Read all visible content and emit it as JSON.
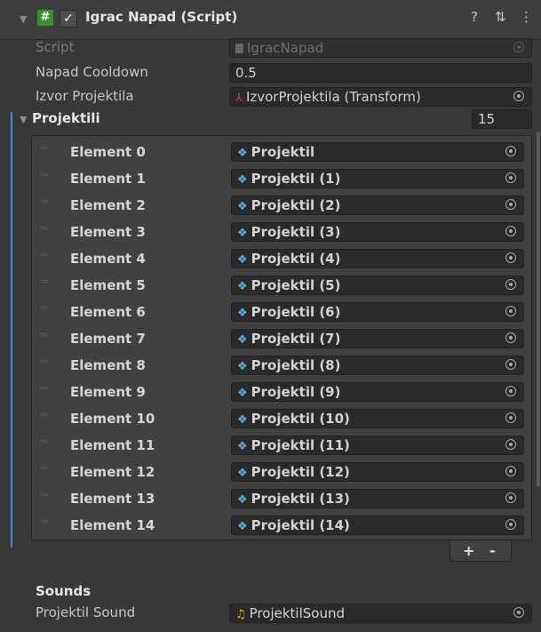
{
  "header": {
    "title": "Igrac Napad (Script)",
    "script_icon_glyph": "#",
    "check_glyph": "✓",
    "help_icon": "?",
    "preset_icon": "⇅",
    "menu_icon": "⋮"
  },
  "fields": {
    "script_label": "Script",
    "script_value": "IgracNapad",
    "cooldown_label": "Napad Cooldown",
    "cooldown_value": "0.5",
    "izvor_label": "Izvor Projektila",
    "izvor_value": "IzvorProjektila (Transform)"
  },
  "projektili": {
    "label": "Projektili",
    "count": "15",
    "elements": [
      {
        "label": "Element 0",
        "value": "Projektil"
      },
      {
        "label": "Element 1",
        "value": "Projektil (1)"
      },
      {
        "label": "Element 2",
        "value": "Projektil (2)"
      },
      {
        "label": "Element 3",
        "value": "Projektil (3)"
      },
      {
        "label": "Element 4",
        "value": "Projektil (4)"
      },
      {
        "label": "Element 5",
        "value": "Projektil (5)"
      },
      {
        "label": "Element 6",
        "value": "Projektil (6)"
      },
      {
        "label": "Element 7",
        "value": "Projektil (7)"
      },
      {
        "label": "Element 8",
        "value": "Projektil (8)"
      },
      {
        "label": "Element 9",
        "value": "Projektil (9)"
      },
      {
        "label": "Element 10",
        "value": "Projektil (10)"
      },
      {
        "label": "Element 11",
        "value": "Projektil (11)"
      },
      {
        "label": "Element 12",
        "value": "Projektil (12)"
      },
      {
        "label": "Element 13",
        "value": "Projektil (13)"
      },
      {
        "label": "Element 14",
        "value": "Projektil (14)"
      }
    ],
    "add_label": "+",
    "remove_label": "-"
  },
  "sounds": {
    "header": "Sounds",
    "label": "Projektil Sound",
    "value": "ProjektilSound"
  },
  "colors": {
    "background": "#383838",
    "field": "#2a2a2a",
    "accent": "#3d8ed6",
    "script_icon": "#3a8d35",
    "prefab_icon": "#5ab3e8",
    "audio_icon": "#ffb700"
  },
  "icons": {
    "prefab": "cube-icon",
    "audio": "music-note-icon",
    "transform": "transform-axes-icon",
    "script": "script-file-icon"
  }
}
